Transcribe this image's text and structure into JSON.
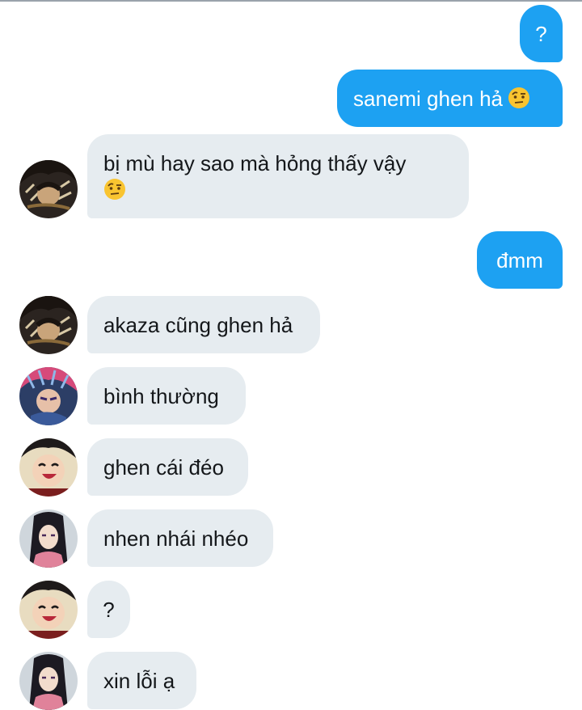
{
  "colors": {
    "outgoing_bubble": "#1da1f2",
    "incoming_bubble": "#e6ecf0",
    "outgoing_text": "#ffffff",
    "incoming_text": "#14171a"
  },
  "messages": [
    {
      "direction": "outgoing",
      "text": "?"
    },
    {
      "direction": "outgoing",
      "text": "sanemi ghen hả",
      "emoji": "face-with-raised-eyebrow-icon"
    },
    {
      "direction": "incoming",
      "avatar": "avatar-dark-haired-character",
      "text_line1": "bị mù hay sao mà hỏng thấy vậy",
      "emoji": "face-with-raised-eyebrow-icon"
    },
    {
      "direction": "outgoing",
      "text": "đmm"
    },
    {
      "direction": "incoming",
      "avatar": "avatar-dark-haired-character",
      "text": "akaza cũng ghen hả"
    },
    {
      "direction": "incoming",
      "avatar": "avatar-pink-haired-character",
      "text": "bình thường"
    },
    {
      "direction": "incoming",
      "avatar": "avatar-laughing-character",
      "text": "ghen cái đéo"
    },
    {
      "direction": "incoming",
      "avatar": "avatar-long-haired-girl",
      "text": "nhen nhái nhéo"
    },
    {
      "direction": "incoming",
      "avatar": "avatar-laughing-character",
      "text": "?"
    },
    {
      "direction": "incoming",
      "avatar": "avatar-long-haired-girl",
      "text": "xin lỗi ạ"
    }
  ]
}
